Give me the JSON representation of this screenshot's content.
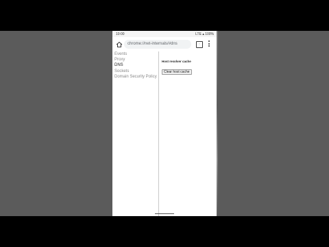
{
  "status_bar": {
    "time": "10:00",
    "indicators": "LTE ▴ 100%"
  },
  "address_bar": {
    "url": "chrome://net-internals/#dns",
    "tab_count": ":"
  },
  "sidebar": {
    "items": [
      {
        "label": "Events",
        "active": false
      },
      {
        "label": "Proxy",
        "active": false
      },
      {
        "label": "DNS",
        "active": true
      },
      {
        "label": "Sockets",
        "active": false
      },
      {
        "label": "Domain Security Policy",
        "active": false
      }
    ]
  },
  "main": {
    "section_title": "Host resolver cache",
    "clear_button_label": "Clear host cache"
  },
  "colors": {
    "background": "#5b5b5b",
    "page": "#ffffff",
    "omnibox": "#f1f3f4"
  }
}
